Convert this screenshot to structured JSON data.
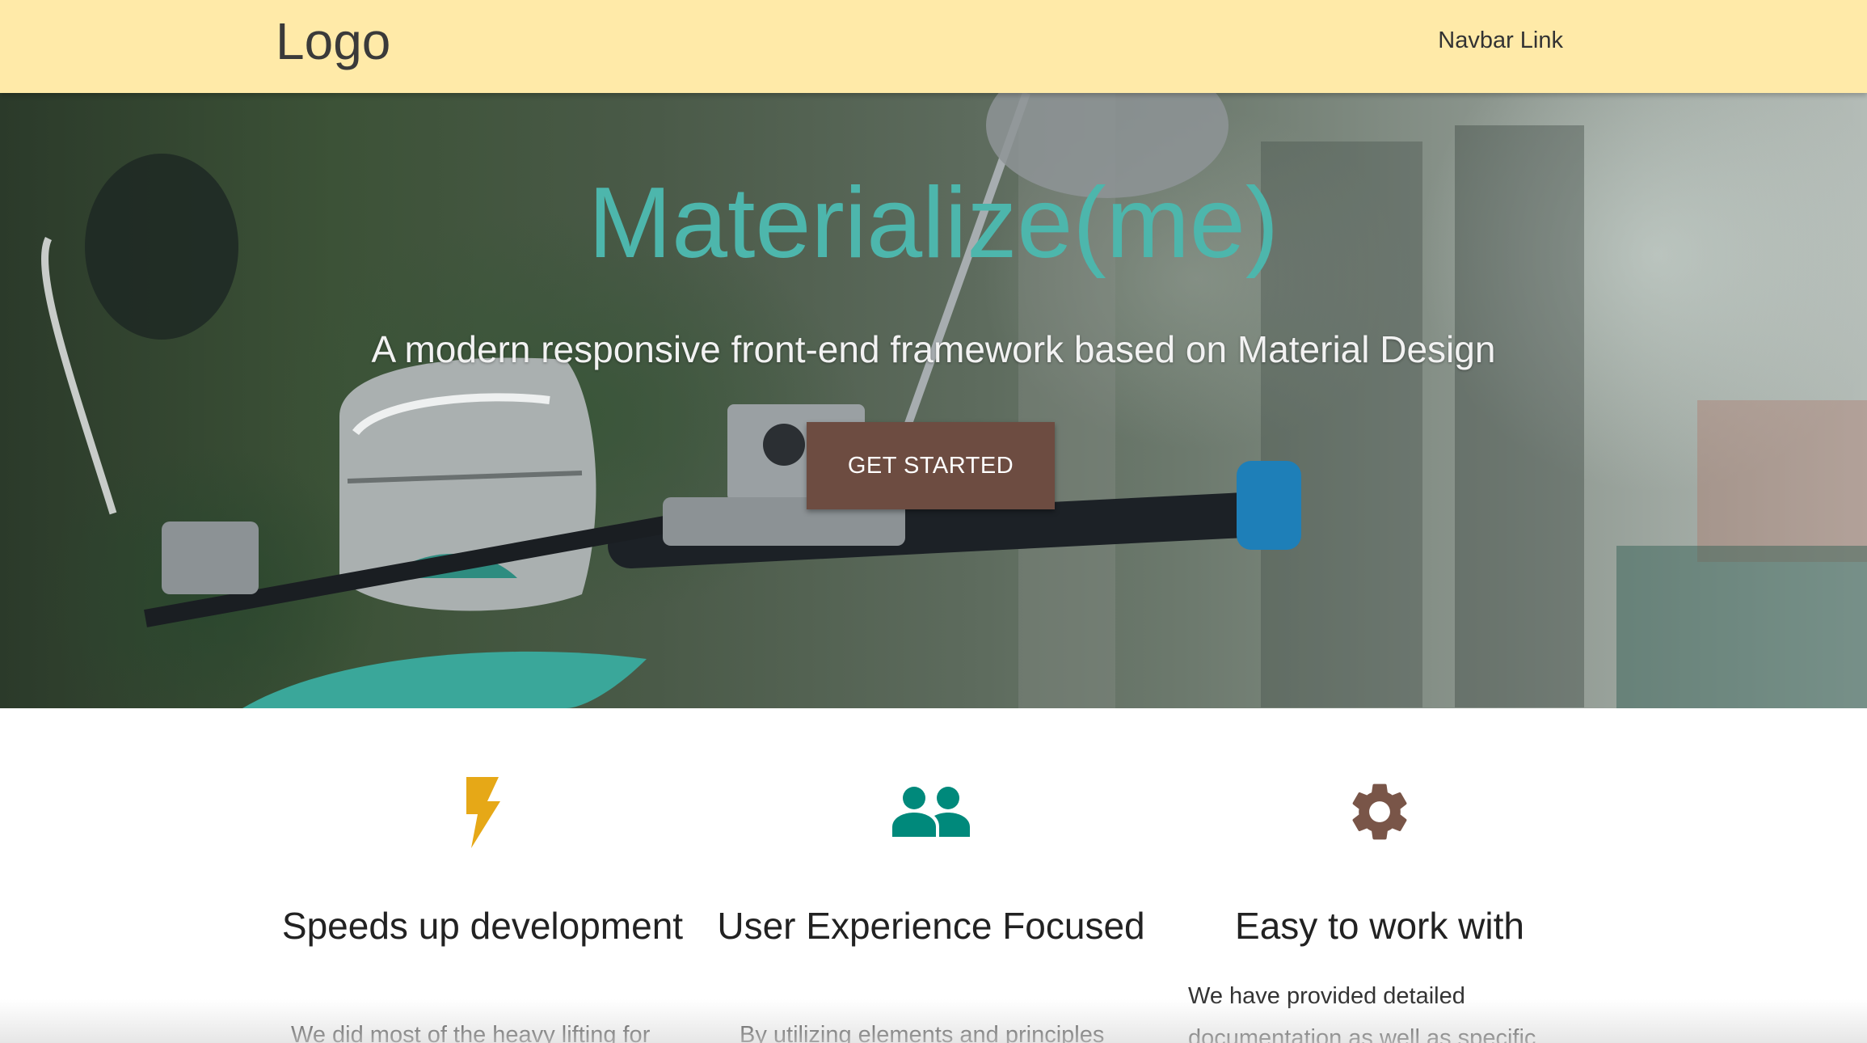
{
  "navbar": {
    "logo": "Logo",
    "link": "Navbar Link",
    "background": "#ffeaa8"
  },
  "hero": {
    "title": "Materialize(me)",
    "subtitle": "A modern responsive front-end framework based on Material Design",
    "button_label": "GET STARTED",
    "title_color": "#4db6ac",
    "button_color": "#6d4c41",
    "background_image": "motorcycle-handlebar-photo"
  },
  "features": [
    {
      "icon": "flash-icon",
      "icon_color": "#e6a817",
      "heading": "Speeds up development",
      "text": "We did most of the heavy lifting for"
    },
    {
      "icon": "group-icon",
      "icon_color": "#00897b",
      "heading": "User Experience Focused",
      "text": "By utilizing elements and principles"
    },
    {
      "icon": "gear-icon",
      "icon_color": "#795548",
      "heading": "Easy to work with",
      "text": "We have provided detailed documentation as well as specific"
    }
  ]
}
